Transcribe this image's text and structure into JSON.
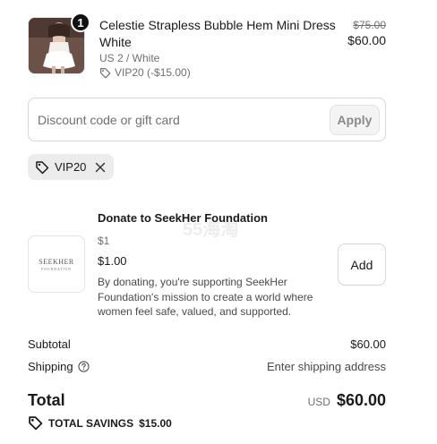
{
  "product": {
    "quantity": "1",
    "title": "Celestie Strapless Bubble Hem Mini Dress White",
    "variant": "US 2 / White",
    "discount_line": "VIP20 (-$15.00)",
    "original_price": "$75.00",
    "price": "$60.00",
    "image_icon": "dress-thumbnail"
  },
  "discount": {
    "placeholder": "Discount code or gift card",
    "value": "",
    "apply_label": "Apply"
  },
  "applied_code": {
    "code": "VIP20",
    "tag_icon": "tag-icon",
    "remove_icon": "close-icon"
  },
  "donation": {
    "title": "Donate to SeekHer Foundation",
    "logo_line1": "SEEKHER",
    "logo_line2": "FOUNDATION",
    "small_amount": "$1",
    "amount": "$1.00",
    "description": "By donating, you're supporting SeekHer Foundation's mission to create a world where women feel safe, valued, and supported.",
    "add_label": "Add"
  },
  "watermark": "55海淘",
  "summary": {
    "subtotal_label": "Subtotal",
    "subtotal_value": "$60.00",
    "shipping_label": "Shipping",
    "shipping_value": "Enter shipping address",
    "total_label": "Total",
    "currency": "USD",
    "total_value": "$60.00",
    "savings_label": "TOTAL SAVINGS",
    "savings_value": "$15.00"
  }
}
